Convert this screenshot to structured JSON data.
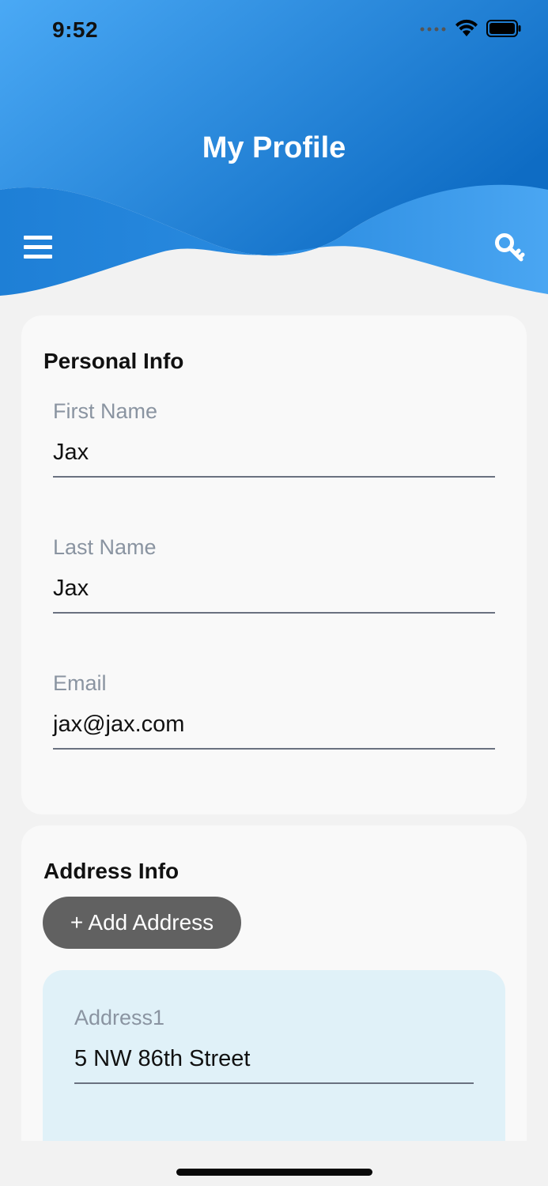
{
  "status_bar": {
    "time": "9:52"
  },
  "header": {
    "title": "My Profile",
    "menu_icon": "hamburger-menu-icon",
    "key_icon": "key-icon",
    "gradient_colors": [
      "#4aa9f5",
      "#0e6cc4"
    ]
  },
  "personal_info": {
    "title": "Personal Info",
    "fields": [
      {
        "label": "First Name",
        "value": "Jax"
      },
      {
        "label": "Last Name",
        "value": "Jax"
      },
      {
        "label": "Email",
        "value": "jax@jax.com"
      }
    ]
  },
  "address_info": {
    "title": "Address Info",
    "add_button_label": "+ Add Address",
    "addresses": [
      {
        "label": "Address1",
        "value": "5 NW 86th Street"
      }
    ]
  },
  "colors": {
    "background": "#f2f2f2",
    "card": "#f9f9f9",
    "address_card": "#e0f1f8",
    "label": "#8a94a1",
    "button": "#616161"
  }
}
